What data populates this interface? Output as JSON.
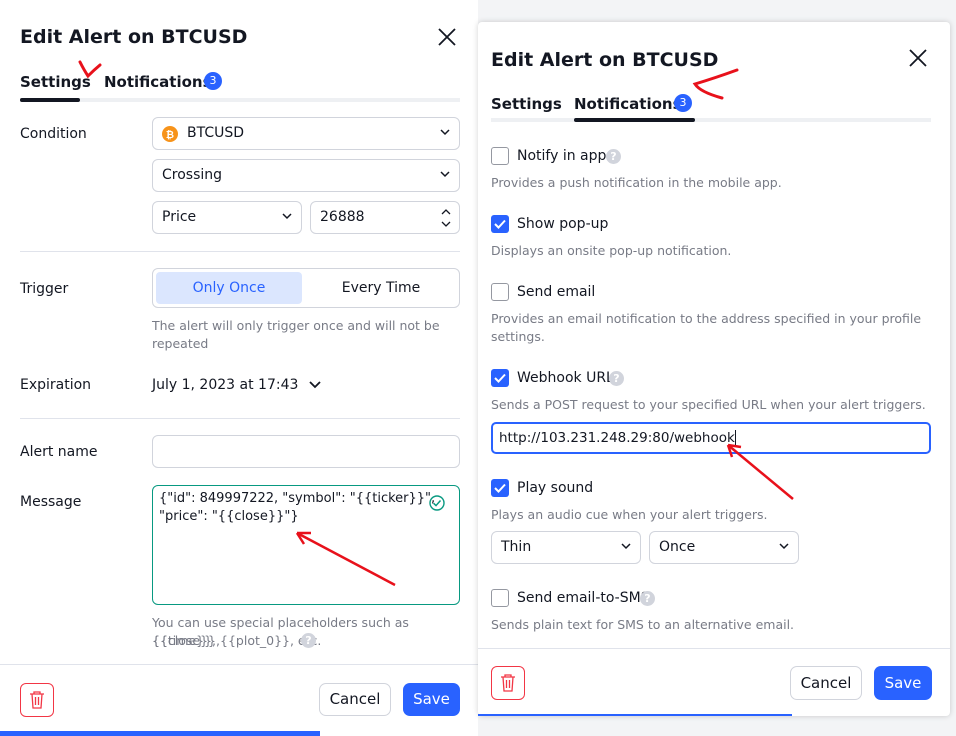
{
  "left": {
    "title": "Edit Alert on BTCUSD",
    "tabs": [
      {
        "label": "Settings"
      },
      {
        "label": "Notifications",
        "badge": "3"
      }
    ],
    "condition": {
      "label": "Condition",
      "symbol": "BTCUSD",
      "operator": "Crossing",
      "source": "Price",
      "value": "26888"
    },
    "trigger": {
      "label": "Trigger",
      "options": [
        "Only Once",
        "Every Time"
      ],
      "selected": "Only Once",
      "hint": "The alert will only trigger once and will not be",
      "hint2": "repeated"
    },
    "expiration": {
      "label": "Expiration",
      "value": "July 1, 2023 at 17:43"
    },
    "alert_name": {
      "label": "Alert name",
      "value": ""
    },
    "message": {
      "label": "Message",
      "line1": "{\"id\": 849997222, \"symbol\": \"{{ticker}}\",",
      "line2": "\"price\": \"{{close}}\"}",
      "hint": "You can use special placeholders such as {{close}},",
      "hint2": "{{time}}, {{plot_0}}, etc."
    },
    "footer": {
      "cancel": "Cancel",
      "save": "Save"
    }
  },
  "right": {
    "title": "Edit Alert on BTCUSD",
    "tabs": [
      {
        "label": "Settings"
      },
      {
        "label": "Notifications",
        "badge": "3"
      }
    ],
    "options": [
      {
        "label": "Notify in app",
        "checked": false,
        "help": true,
        "desc": "Provides a push notification in the mobile app."
      },
      {
        "label": "Show pop-up",
        "checked": true,
        "help": false,
        "desc": "Displays an onsite pop-up notification."
      },
      {
        "label": "Send email",
        "checked": false,
        "help": false,
        "desc": "Provides an email notification to the address specified in your profile",
        "desc2": "settings."
      },
      {
        "label": "Webhook URL",
        "checked": true,
        "help": true,
        "desc": "Sends a POST request to your specified URL when your alert triggers."
      },
      {
        "label": "Play sound",
        "checked": true,
        "help": false,
        "desc": "Plays an audio cue when your alert triggers."
      },
      {
        "label": "Send email-to-SMS",
        "checked": false,
        "help": true,
        "desc": "Sends plain text for SMS to an alternative email."
      }
    ],
    "webhook_url": "http://103.231.248.29:80/webhook",
    "sound": {
      "name": "Thin",
      "repeat": "Once"
    },
    "footer": {
      "cancel": "Cancel",
      "save": "Save"
    }
  },
  "colors": {
    "accent": "#2962ff",
    "danger": "#f23645",
    "annotation": "#e8111b",
    "success": "#089981"
  }
}
